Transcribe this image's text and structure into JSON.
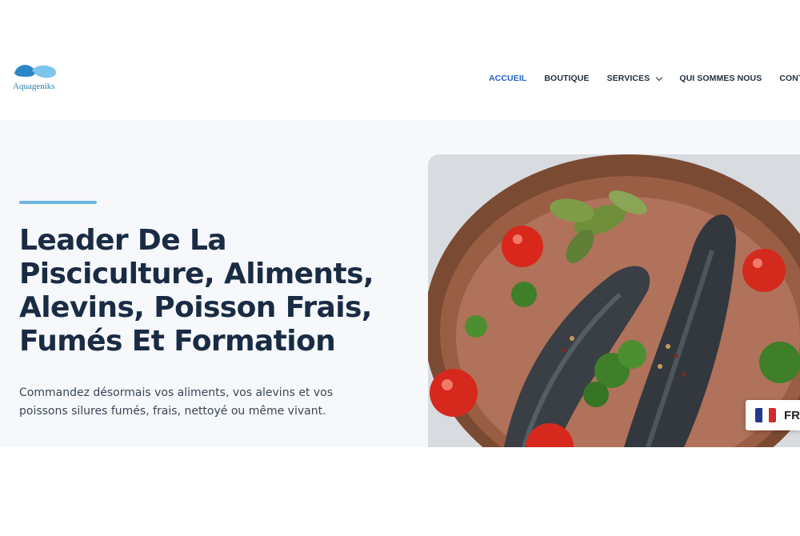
{
  "brand": {
    "name": "Aquageniks",
    "logo_colors": [
      "#2a86c6",
      "#7fc4ec"
    ]
  },
  "nav": {
    "items": [
      {
        "label": "ACCUEIL",
        "active": true
      },
      {
        "label": "BOUTIQUE",
        "active": false
      },
      {
        "label": "SERVICES",
        "active": false,
        "has_dropdown": true
      },
      {
        "label": "QUI SOMMES NOUS",
        "active": false
      },
      {
        "label": "CONTACT",
        "active": false
      }
    ]
  },
  "hero": {
    "title_lines": [
      "Leader De La",
      "Pisciculture, Aliments,",
      "Alevins, Poisson Frais,",
      "Fumés Et Formation"
    ],
    "subtitle_lines": [
      "Commandez désormais vos aliments, vos alevins et vos",
      "poissons silures fumés, frais, nettoyé ou même vivant."
    ],
    "image_icon": "fish-dish-photo"
  },
  "language_switcher": {
    "code": "FR",
    "flag_icon": "france-flag-icon"
  },
  "colors": {
    "accent": "#6bb6e0",
    "active_nav": "#2563c0",
    "heading": "#1a2b44",
    "hero_bg": "#f6f8fb"
  }
}
